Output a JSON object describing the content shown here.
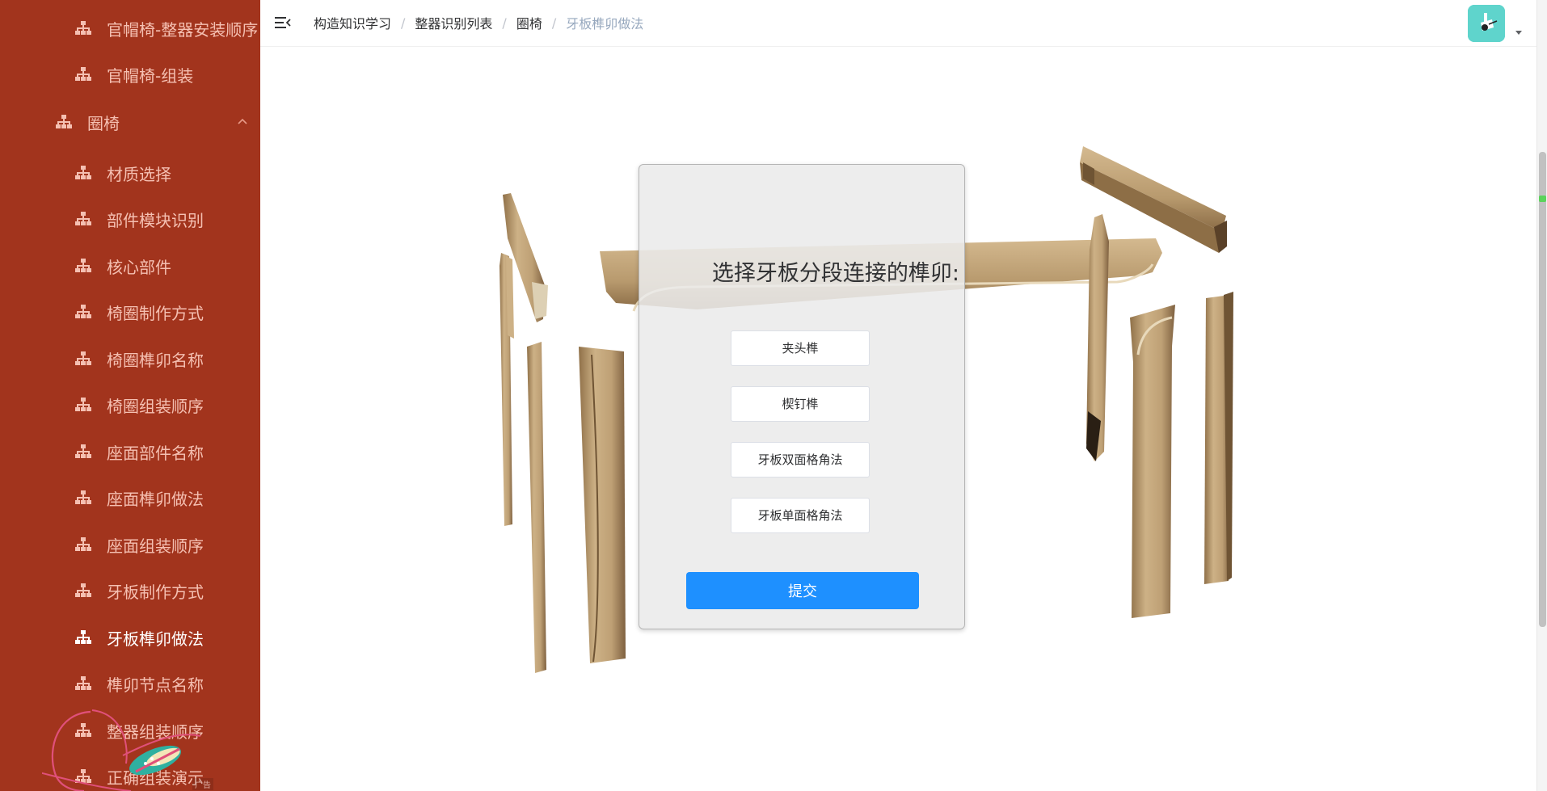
{
  "sidebar": {
    "items": [
      {
        "label": "官帽椅-整器安装顺序",
        "icon": "sitemap-icon"
      },
      {
        "label": "官帽椅-组装",
        "icon": "sitemap-icon"
      },
      {
        "label": "圈椅",
        "icon": "sitemap-icon",
        "expanded": true
      },
      {
        "label": "材质选择",
        "icon": "sitemap-icon"
      },
      {
        "label": "部件模块识别",
        "icon": "sitemap-icon"
      },
      {
        "label": "核心部件",
        "icon": "sitemap-icon"
      },
      {
        "label": "椅圈制作方式",
        "icon": "sitemap-icon"
      },
      {
        "label": "椅圈榫卯名称",
        "icon": "sitemap-icon"
      },
      {
        "label": "椅圈组装顺序",
        "icon": "sitemap-icon"
      },
      {
        "label": "座面部件名称",
        "icon": "sitemap-icon"
      },
      {
        "label": "座面榫卯做法",
        "icon": "sitemap-icon"
      },
      {
        "label": "座面组装顺序",
        "icon": "sitemap-icon"
      },
      {
        "label": "牙板制作方式",
        "icon": "sitemap-icon"
      },
      {
        "label": "牙板榫卯做法",
        "icon": "sitemap-icon",
        "active": true
      },
      {
        "label": "榫卯节点名称",
        "icon": "sitemap-icon"
      },
      {
        "label": "整器组装顺序",
        "icon": "sitemap-icon"
      },
      {
        "label": "正确组装演示",
        "icon": "sitemap-icon"
      }
    ],
    "ad_tag": "广告"
  },
  "header": {
    "breadcrumb": [
      "构造知识学习",
      "整器识别列表",
      "圈椅",
      "牙板榫卯做法"
    ],
    "separator": "/"
  },
  "question": {
    "title": "选择牙板分段连接的榫卯:",
    "options": [
      "夹头榫",
      "楔钉榫",
      "牙板双面格角法",
      "牙板单面格角法"
    ],
    "submit_label": "提交"
  },
  "colors": {
    "sidebar_bg": "#a2341d",
    "sidebar_text": "#f5c0b2",
    "sidebar_active": "#ffffff",
    "primary": "#1e90ff",
    "avatar_bg": "#5fd4cc",
    "wood": "#c2a57e"
  }
}
